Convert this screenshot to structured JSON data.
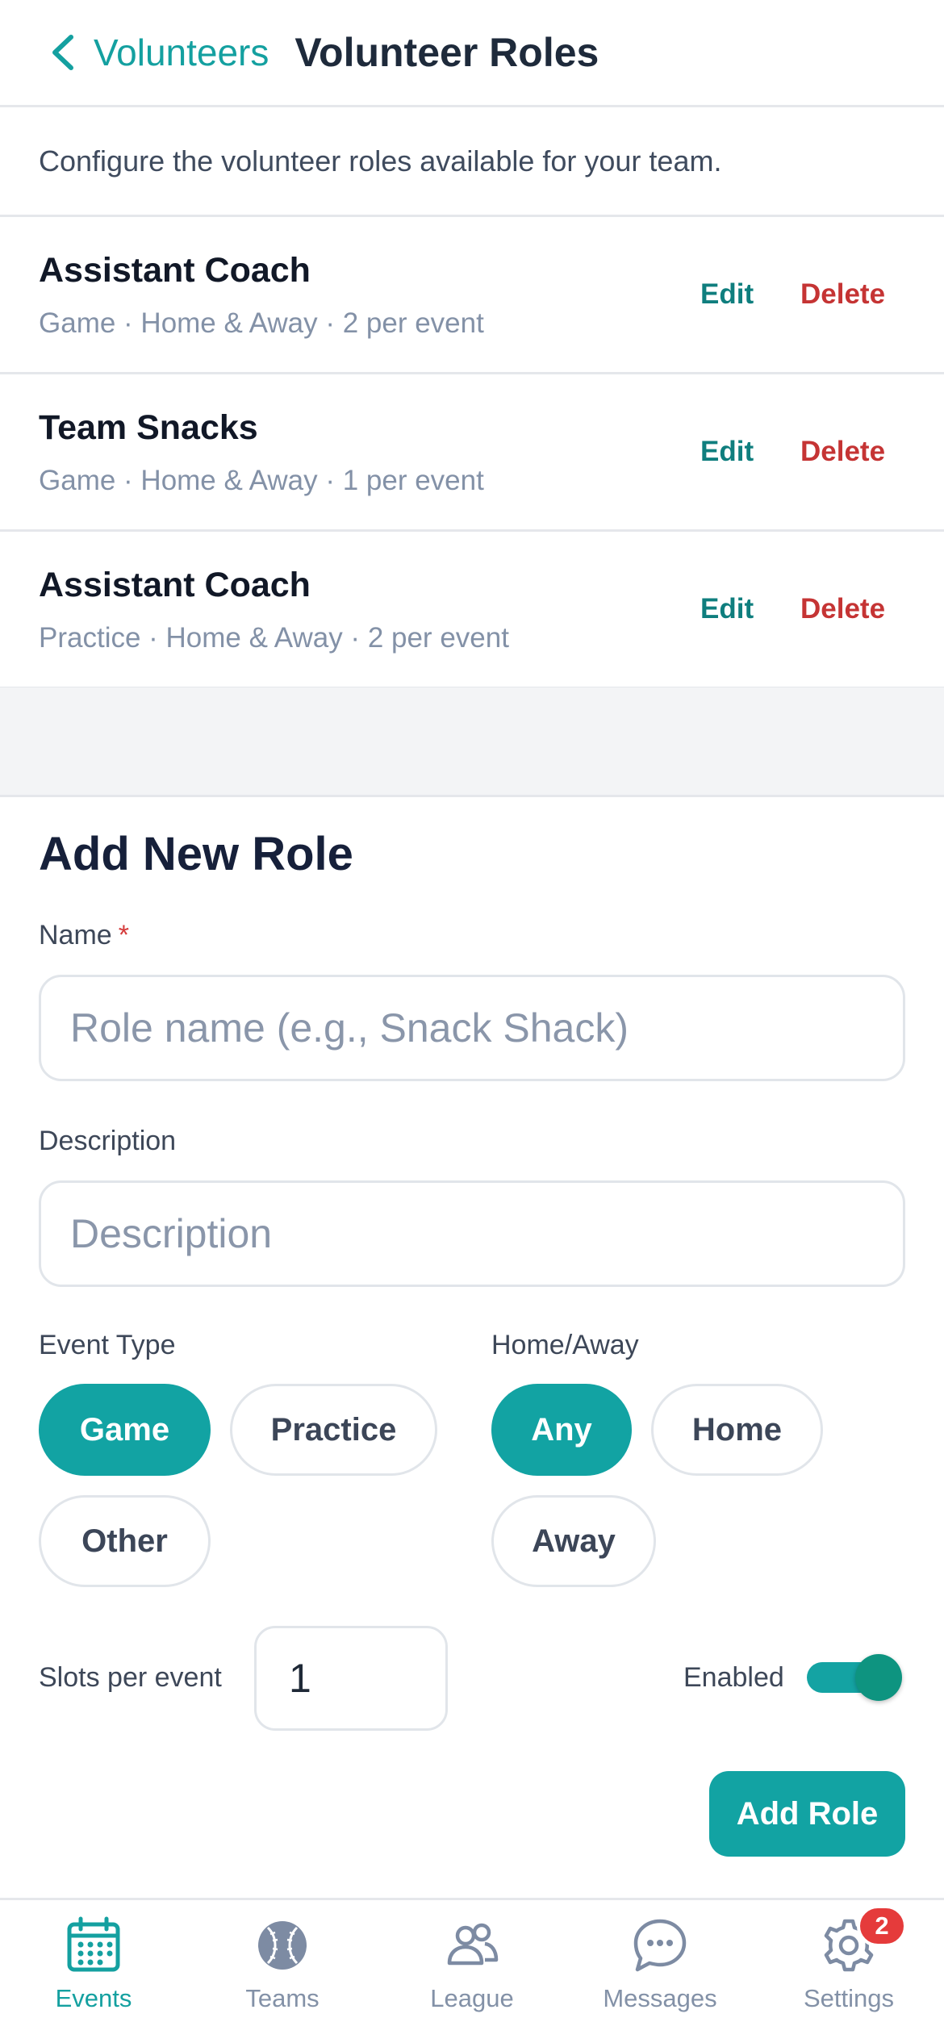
{
  "header": {
    "back_label": "Volunteers",
    "title": "Volunteer Roles"
  },
  "intro": "Configure the volunteer roles available for your team.",
  "roles": [
    {
      "name": "Assistant Coach",
      "meta": "Game · Home & Away · 2 per event",
      "edit_label": "Edit",
      "delete_label": "Delete"
    },
    {
      "name": "Team Snacks",
      "meta": "Game · Home & Away · 1 per event",
      "edit_label": "Edit",
      "delete_label": "Delete"
    },
    {
      "name": "Assistant Coach",
      "meta": "Practice · Home & Away · 2 per event",
      "edit_label": "Edit",
      "delete_label": "Delete"
    }
  ],
  "form": {
    "title": "Add New Role",
    "name_label": "Name",
    "required_mark": "*",
    "name_placeholder": "Role name (e.g., Snack Shack)",
    "description_label": "Description",
    "description_placeholder": "Description",
    "event_type_label": "Event Type",
    "event_types": [
      "Game",
      "Practice",
      "Other"
    ],
    "event_type_selected": "Game",
    "home_away_label": "Home/Away",
    "home_away_options": [
      "Any",
      "Home",
      "Away"
    ],
    "home_away_selected": "Any",
    "slots_label": "Slots per event",
    "slots_value": "1",
    "enabled_label": "Enabled",
    "enabled": true,
    "submit_label": "Add Role"
  },
  "bottom_nav": {
    "items": [
      {
        "label": "Events",
        "icon": "calendar-icon",
        "active": true
      },
      {
        "label": "Teams",
        "icon": "baseball-icon",
        "active": false
      },
      {
        "label": "League",
        "icon": "people-icon",
        "active": false
      },
      {
        "label": "Messages",
        "icon": "chat-bubble-icon",
        "active": false
      },
      {
        "label": "Settings",
        "icon": "gear-icon",
        "active": false,
        "badge": "2"
      }
    ]
  },
  "colors": {
    "accent": "#12a3a3",
    "delete": "#c53434",
    "badge": "#e53b3b"
  }
}
